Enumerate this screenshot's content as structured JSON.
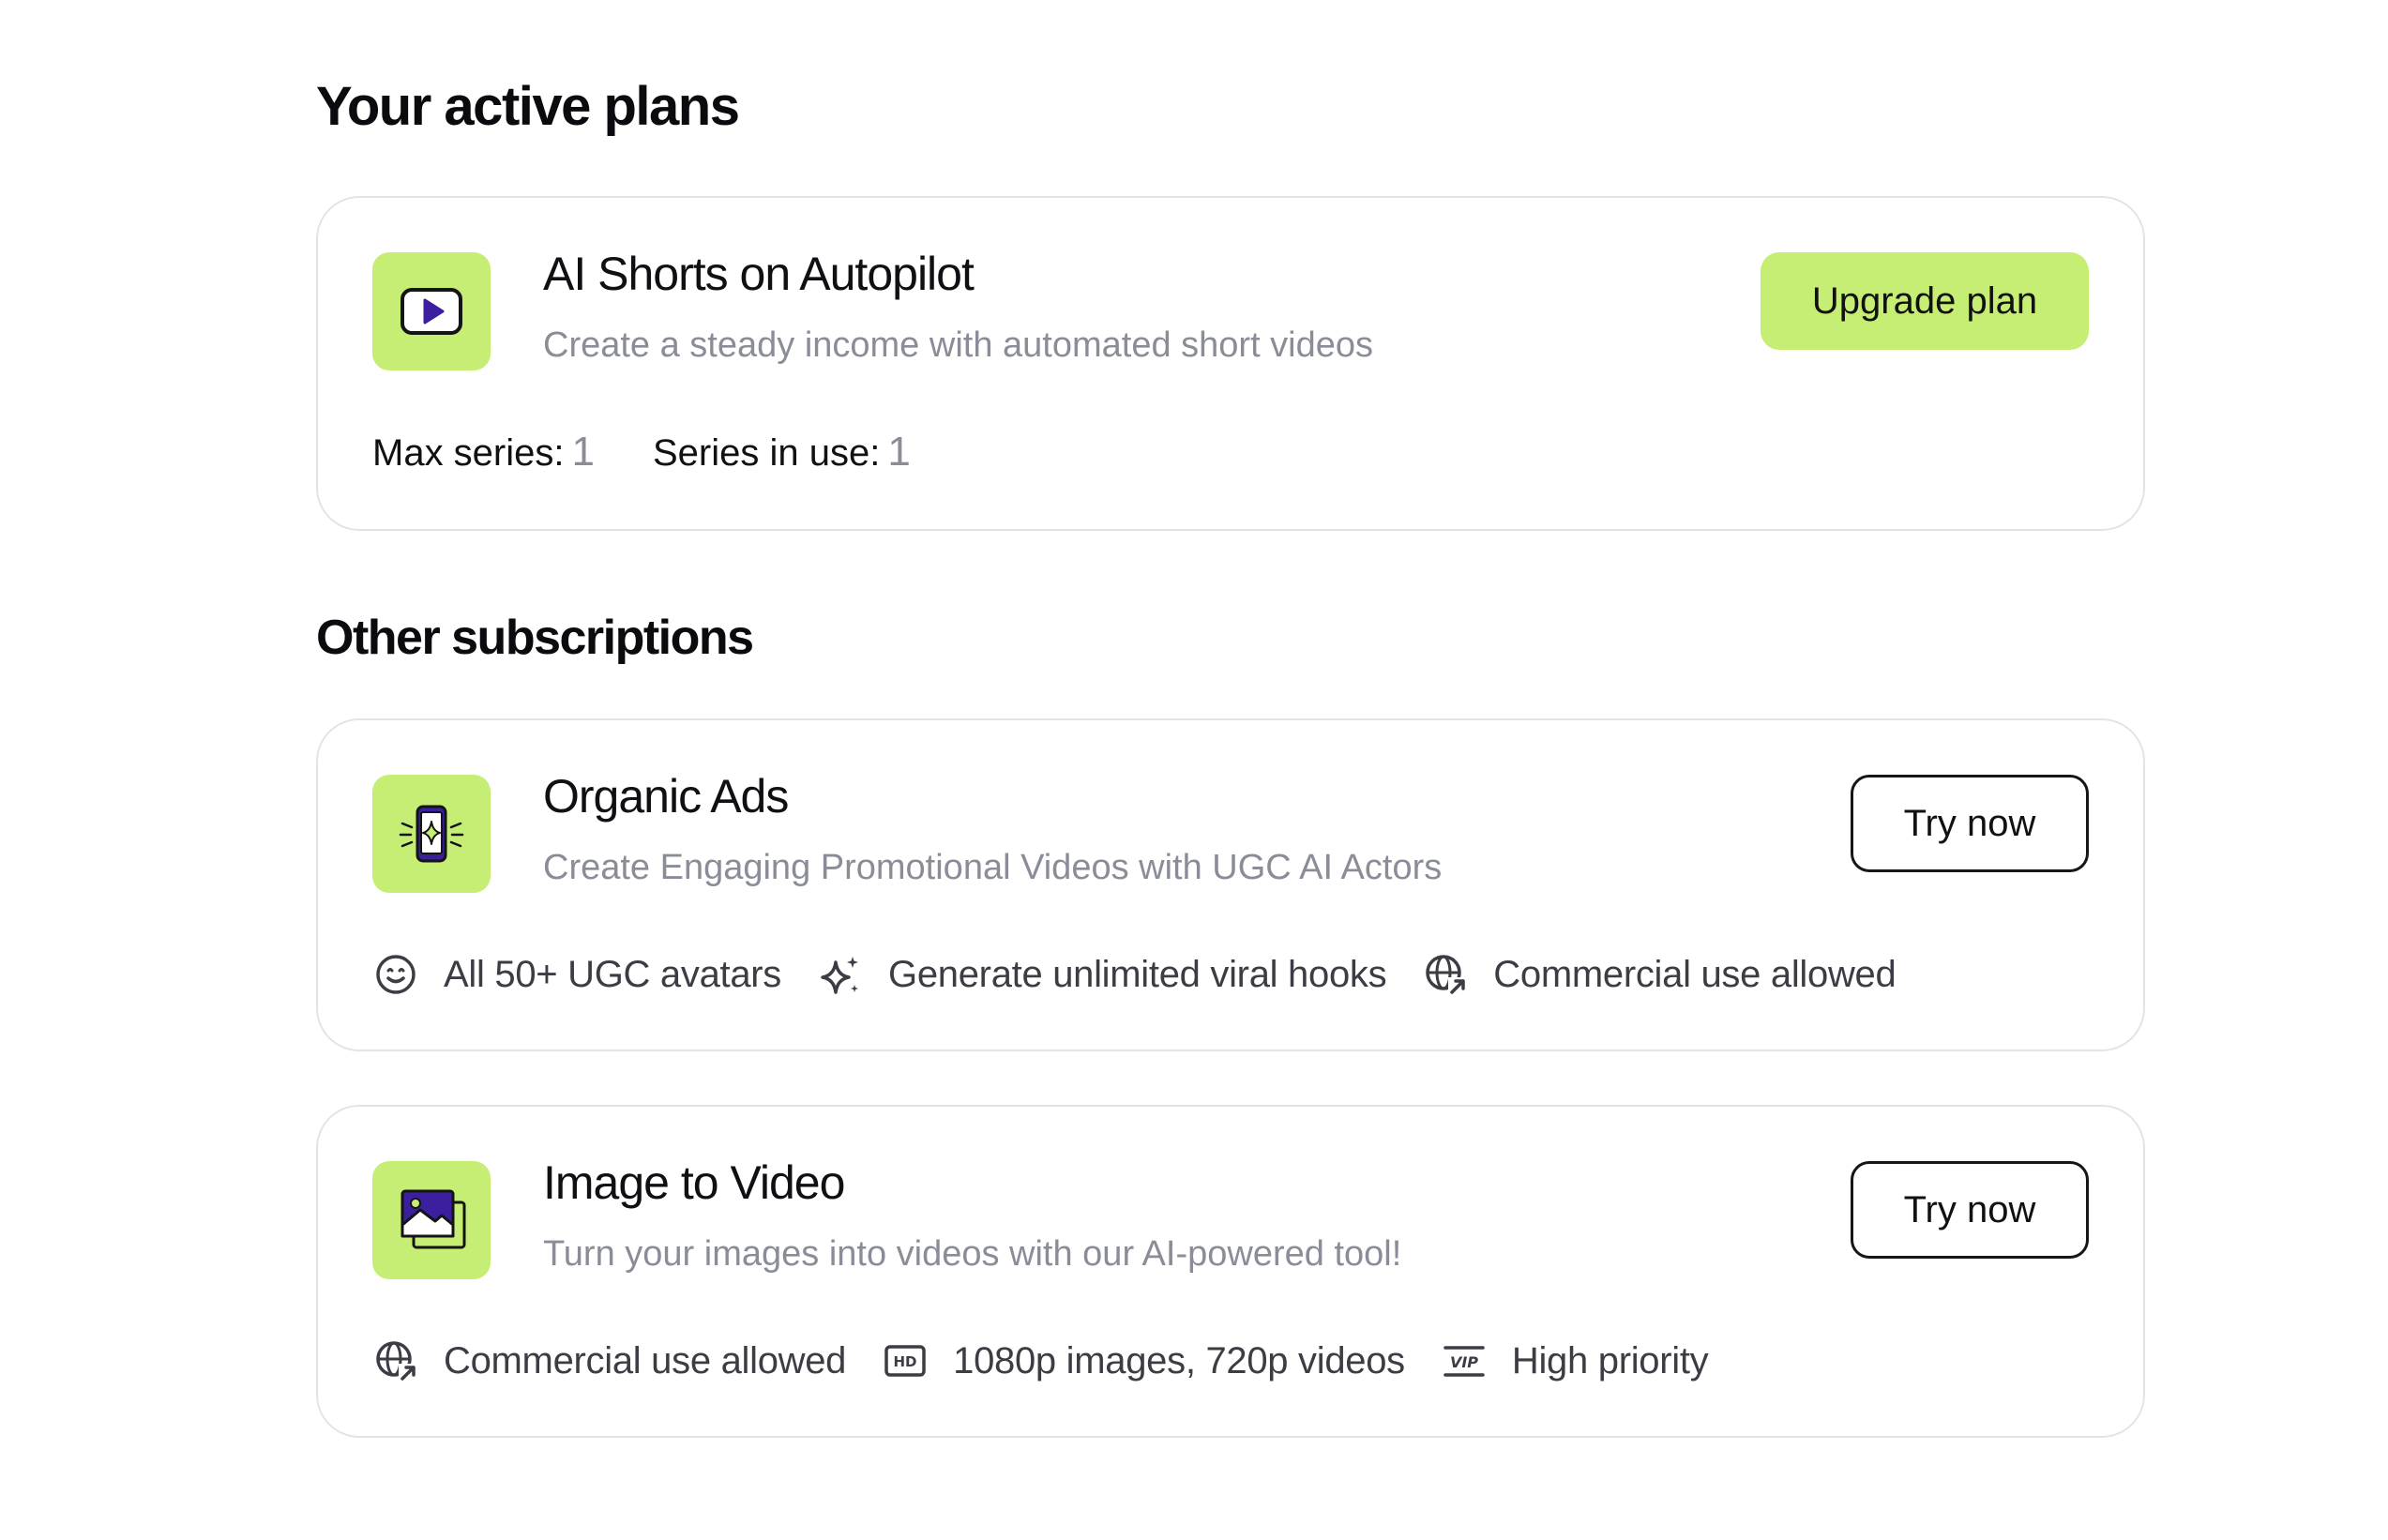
{
  "active_section": {
    "title": "Your active plans",
    "plan": {
      "icon": "video-play-icon",
      "title": "AI Shorts on Autopilot",
      "subtitle": "Create a steady income with automated short videos",
      "button_label": "Upgrade plan",
      "stats": [
        {
          "label": "Max series:",
          "value": "1"
        },
        {
          "label": "Series in use:",
          "value": "1"
        }
      ]
    }
  },
  "other_section": {
    "title": "Other subscriptions",
    "subscriptions": [
      {
        "icon": "phone-sparkle-icon",
        "title": "Organic Ads",
        "subtitle": "Create Engaging Promotional Videos with UGC AI Actors",
        "button_label": "Try now",
        "features": [
          {
            "icon": "smiley-icon",
            "text": "All 50+ UGC avatars"
          },
          {
            "icon": "sparkles-icon",
            "text": "Generate unlimited viral hooks"
          },
          {
            "icon": "globe-arrow-icon",
            "text": "Commercial use allowed"
          }
        ]
      },
      {
        "icon": "image-stack-icon",
        "title": "Image to Video",
        "subtitle": "Turn your images into videos with our AI-powered tool!",
        "button_label": "Try now",
        "features": [
          {
            "icon": "globe-arrow-icon",
            "text": "Commercial use allowed"
          },
          {
            "icon": "hd-icon",
            "text": "1080p images, 720p videos"
          },
          {
            "icon": "vip-icon",
            "text": "High priority"
          }
        ]
      }
    ]
  },
  "colors": {
    "accent": "#c6ee74",
    "brand_purple": "#3b1f9e",
    "muted_text": "#8a8d98",
    "border": "#e3e4e8"
  }
}
